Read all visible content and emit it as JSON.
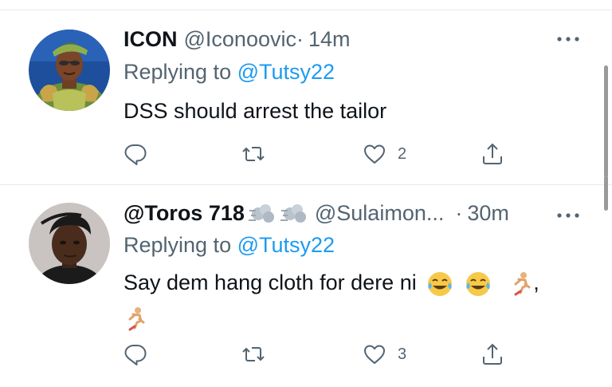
{
  "tweets": [
    {
      "name": "ICON",
      "handle": "@Iconoovic",
      "separator": "·",
      "time": "14m",
      "replying_prefix": "Replying to ",
      "replying_to": "@Tutsy22",
      "text": "DSS should arrest the tailor",
      "likes": "2",
      "avatar_icon": "avatar-woman-headwrap"
    },
    {
      "name": "@Toros 718",
      "name_emojis": [
        "dash-emoji",
        "dash-emoji"
      ],
      "handle": "@Sulaimon...",
      "separator": "·",
      "time": "30m",
      "replying_prefix": "Replying to ",
      "replying_to": "@Tutsy22",
      "text_line1": "Say dem hang cloth for dere ni",
      "text_line1_emojis": [
        "joy-emoji",
        "joy-emoji",
        "running-emoji"
      ],
      "text_line1_suffix": ",",
      "text_line2_emojis": [
        "running-emoji"
      ],
      "likes": "3",
      "avatar_icon": "avatar-man"
    }
  ],
  "icons": {
    "reply": "reply-icon",
    "retweet": "retweet-icon",
    "like": "heart-icon",
    "share": "share-icon",
    "more": "more-icon"
  },
  "colors": {
    "text": "#0f1419",
    "secondary": "#536471",
    "link": "#1d9bf0",
    "divider": "#e6ecf0"
  }
}
